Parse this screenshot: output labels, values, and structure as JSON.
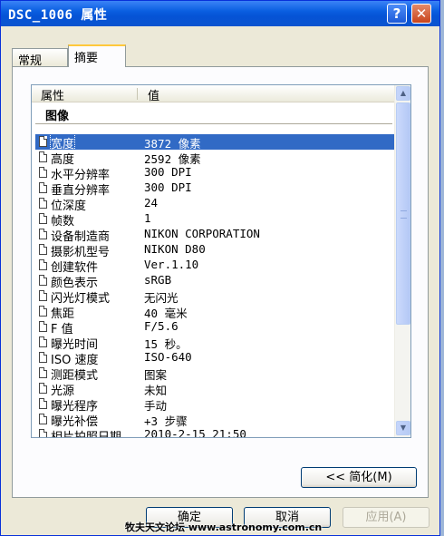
{
  "window": {
    "title": "DSC_1006 属性",
    "help_label": "?",
    "close_label": "✕"
  },
  "tabs": [
    {
      "label": "常规",
      "active": false
    },
    {
      "label": "摘要",
      "active": true
    }
  ],
  "list": {
    "header": {
      "property": "属性",
      "value": "值"
    },
    "group": "图像",
    "rows": [
      {
        "key": "宽度",
        "value": "3872 像素",
        "selected": true
      },
      {
        "key": "高度",
        "value": "2592 像素"
      },
      {
        "key": "水平分辨率",
        "value": "300 DPI"
      },
      {
        "key": "垂直分辨率",
        "value": "300 DPI"
      },
      {
        "key": "位深度",
        "value": "24"
      },
      {
        "key": "帧数",
        "value": "1"
      },
      {
        "key": "设备制造商",
        "value": "NIKON CORPORATION"
      },
      {
        "key": "摄影机型号",
        "value": "NIKON D80"
      },
      {
        "key": "创建软件",
        "value": "Ver.1.10"
      },
      {
        "key": "颜色表示",
        "value": "sRGB"
      },
      {
        "key": "闪光灯模式",
        "value": "无闪光"
      },
      {
        "key": "焦距",
        "value": "40 毫米"
      },
      {
        "key": "F 值",
        "value": "F/5.6"
      },
      {
        "key": "曝光时间",
        "value": "15 秒。"
      },
      {
        "key": "ISO 速度",
        "value": "ISO-640"
      },
      {
        "key": "测距模式",
        "value": "图案"
      },
      {
        "key": "光源",
        "value": "未知"
      },
      {
        "key": "曝光程序",
        "value": "手动"
      },
      {
        "key": "曝光补偿",
        "value": "+3 步骤"
      },
      {
        "key": "相片拍照日期",
        "value": "2010-2-15 21:50"
      }
    ]
  },
  "buttons": {
    "simplify": "<< 简化(M)",
    "ok": "确定",
    "cancel": "取消",
    "apply": "应用(A)"
  },
  "watermark": "牧夫天文论坛 www.astronomy.com.cn"
}
